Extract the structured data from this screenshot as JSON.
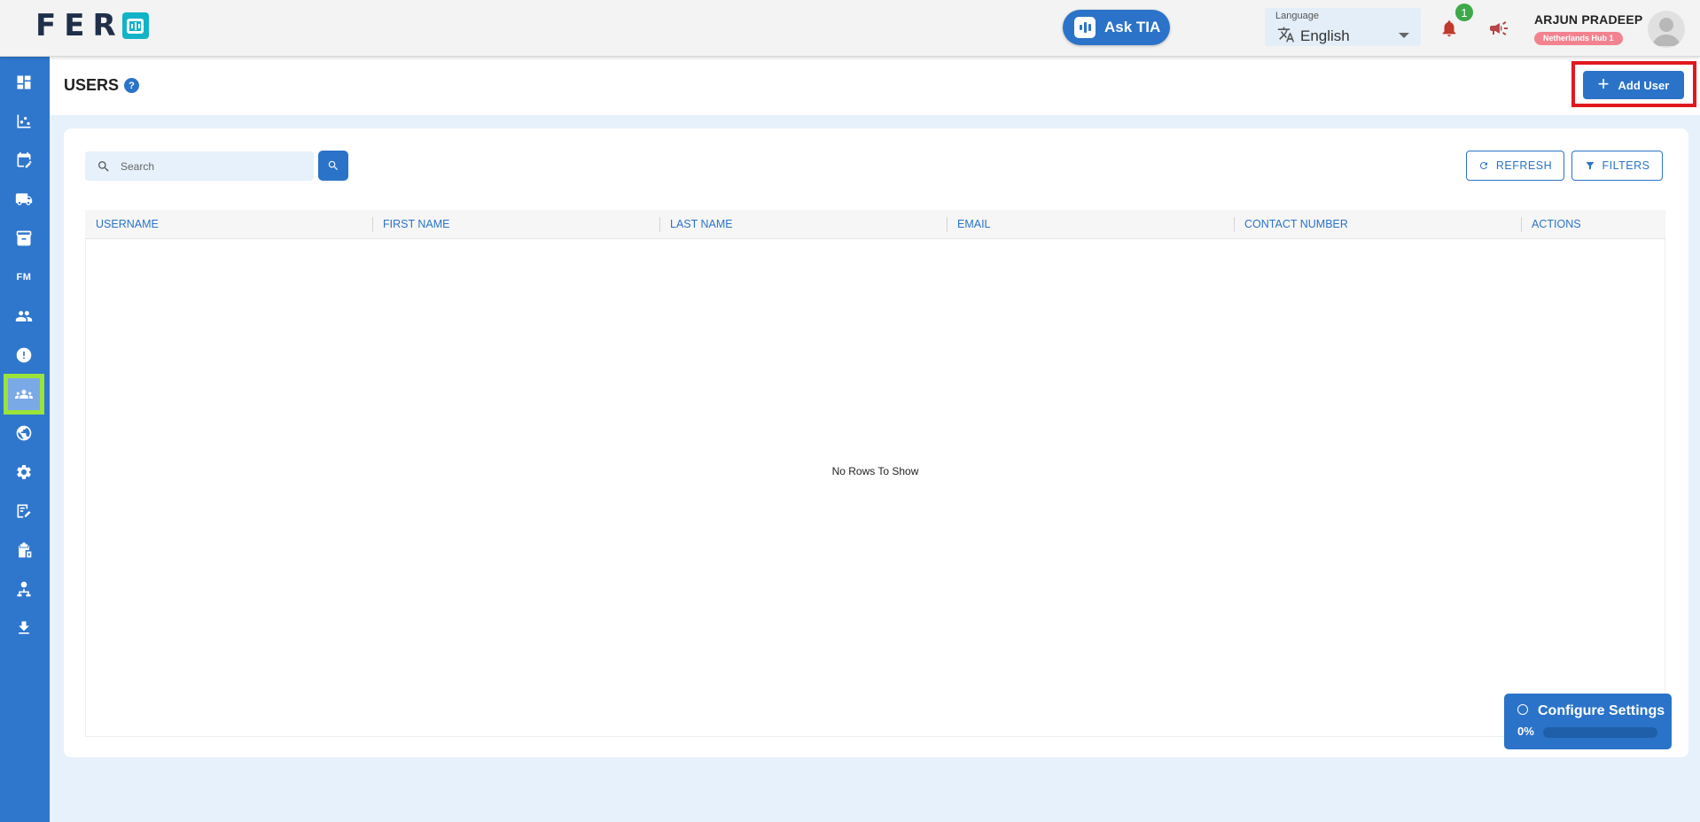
{
  "app": {
    "logo_text": "FER"
  },
  "header": {
    "ask_tia_label": "Ask TIA",
    "language": {
      "label": "Language",
      "value": "English"
    },
    "notifications_count": "1",
    "user": {
      "name": "ARJUN PRADEEP",
      "hub": "Netherlands Hub 1"
    }
  },
  "sidebar": {
    "items": [
      {
        "name": "dashboard",
        "label": ""
      },
      {
        "name": "analytics",
        "label": ""
      },
      {
        "name": "planner",
        "label": ""
      },
      {
        "name": "trucks",
        "label": ""
      },
      {
        "name": "archive",
        "label": ""
      },
      {
        "name": "fm",
        "label": "FM"
      },
      {
        "name": "people",
        "label": ""
      },
      {
        "name": "alerts",
        "label": ""
      },
      {
        "name": "users",
        "label": "",
        "active": true
      },
      {
        "name": "globe",
        "label": ""
      },
      {
        "name": "settings",
        "label": ""
      },
      {
        "name": "notes",
        "label": ""
      },
      {
        "name": "clipboard",
        "label": ""
      },
      {
        "name": "person-tree",
        "label": ""
      },
      {
        "name": "download",
        "label": ""
      }
    ]
  },
  "page": {
    "title": "USERS",
    "help_glyph": "?",
    "add_user_label": "Add User"
  },
  "toolbar": {
    "search_placeholder": "Search",
    "refresh_label": "REFRESH",
    "filters_label": "FILTERS"
  },
  "table": {
    "columns": [
      "USERNAME",
      "FIRST NAME",
      "LAST NAME",
      "EMAIL",
      "CONTACT NUMBER",
      "ACTIONS"
    ],
    "empty_text": "No Rows To Show"
  },
  "config_widget": {
    "title": "Configure Settings",
    "progress_label": "0%",
    "progress": 0
  },
  "colors": {
    "primary": "#2b73c8",
    "sidebar": "#2f76cd",
    "active_highlight": "#9be33a",
    "add_user_highlight": "#e0191f",
    "badge_green": "#3ea84a",
    "hub_badge": "#f3828f",
    "bell": "#c0392b"
  }
}
